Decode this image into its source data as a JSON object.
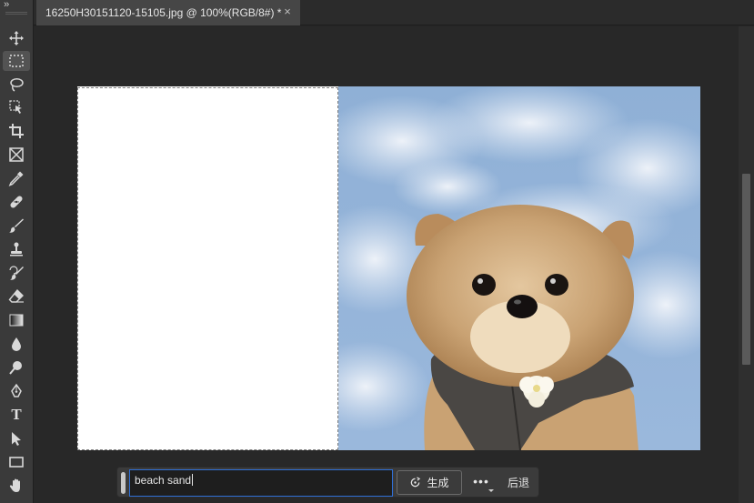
{
  "document": {
    "tab_title": "16250H30151120-15105.jpg @ 100%(RGB/8#) *",
    "close_glyph": "×"
  },
  "toolbar": {
    "collapse_glyph": "››",
    "tools": [
      {
        "name": "move-tool",
        "icon": "move-icon"
      },
      {
        "name": "rectangular-marquee-tool",
        "icon": "marquee-icon",
        "active": true
      },
      {
        "name": "lasso-tool",
        "icon": "lasso-icon"
      },
      {
        "name": "object-selection-tool",
        "icon": "object-selection-icon"
      },
      {
        "name": "crop-tool",
        "icon": "crop-icon"
      },
      {
        "name": "frame-tool",
        "icon": "frame-icon"
      },
      {
        "name": "eyedropper-tool",
        "icon": "eyedropper-icon"
      },
      {
        "name": "spot-healing-tool",
        "icon": "bandage-icon"
      },
      {
        "name": "brush-tool",
        "icon": "brush-icon"
      },
      {
        "name": "clone-stamp-tool",
        "icon": "stamp-icon"
      },
      {
        "name": "history-brush-tool",
        "icon": "history-brush-icon"
      },
      {
        "name": "eraser-tool",
        "icon": "eraser-icon"
      },
      {
        "name": "gradient-tool",
        "icon": "gradient-icon"
      },
      {
        "name": "blur-tool",
        "icon": "drop-icon"
      },
      {
        "name": "dodge-tool",
        "icon": "dodge-icon"
      },
      {
        "name": "pen-tool",
        "icon": "pen-icon"
      },
      {
        "name": "type-tool",
        "icon": "type-icon",
        "glyph": "T"
      },
      {
        "name": "path-selection-tool",
        "icon": "arrow-icon"
      },
      {
        "name": "rectangle-tool",
        "icon": "rectangle-icon"
      },
      {
        "name": "hand-tool",
        "icon": "hand-icon"
      }
    ]
  },
  "taskbar": {
    "prompt_value": "beach sand",
    "generate_label": "生成",
    "more_label": "•••",
    "undo_label": "后退"
  },
  "colors": {
    "selection_accent": "#2f6fd6",
    "sky": "#8fb0d6",
    "dog_fur": "#c9a273",
    "vest": "#4a4744"
  }
}
